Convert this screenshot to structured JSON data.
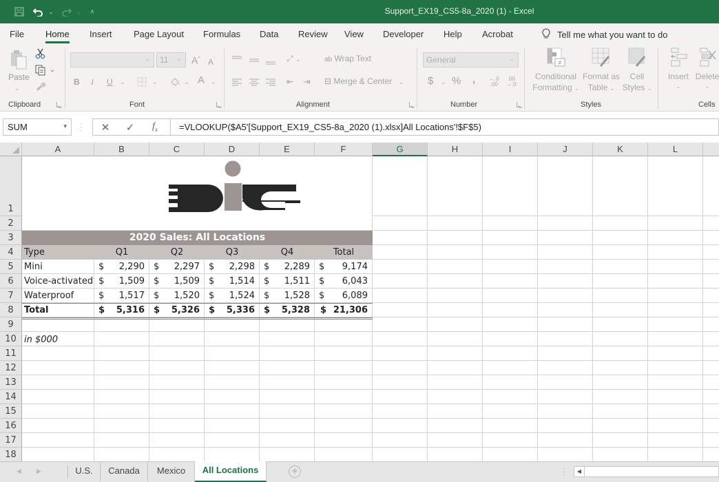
{
  "window": {
    "title": "Support_EX19_CS5-8a_2020 (1)  -  Excel",
    "qat": [
      "save-icon",
      "undo-icon",
      "redo-icon",
      "customize-qat-icon"
    ]
  },
  "ribbon_tabs": [
    {
      "label": "File"
    },
    {
      "label": "Home",
      "active": true
    },
    {
      "label": "Insert"
    },
    {
      "label": "Page Layout"
    },
    {
      "label": "Formulas"
    },
    {
      "label": "Data"
    },
    {
      "label": "Review"
    },
    {
      "label": "View"
    },
    {
      "label": "Developer"
    },
    {
      "label": "Help"
    },
    {
      "label": "Acrobat"
    }
  ],
  "tell_me": "Tell me what you want to do",
  "ribbon": {
    "clipboard": {
      "label": "Clipboard",
      "paste": "Paste"
    },
    "font": {
      "label": "Font",
      "font_name": "",
      "font_size": "11",
      "bold": "B",
      "italic": "I",
      "underline": "U"
    },
    "alignment": {
      "label": "Alignment",
      "wrap_text": "Wrap Text",
      "merge_center": "Merge & Center"
    },
    "number": {
      "label": "Number",
      "format": "General",
      "currency": "$",
      "percent": "%",
      "comma": ","
    },
    "styles": {
      "label": "Styles",
      "conditional_1": "Conditional",
      "conditional_2": "Formatting",
      "format_table_1": "Format as",
      "format_table_2": "Table",
      "cell_styles_1": "Cell",
      "cell_styles_2": "Styles"
    },
    "cells": {
      "label": "Cells",
      "insert": "Insert",
      "delete": "Delete"
    }
  },
  "formula_bar": {
    "name_box": "SUM",
    "formula": "=VLOOKUP($A5'[Support_EX19_CS5-8a_2020 (1).xlsx]All Locations'!$F$5)"
  },
  "columns": [
    "A",
    "B",
    "C",
    "D",
    "E",
    "F",
    "G",
    "H",
    "I",
    "J",
    "K",
    "L"
  ],
  "selected_column": "G",
  "rows": [
    "1",
    "2",
    "3",
    "4",
    "5",
    "6",
    "7",
    "8",
    "9",
    "10",
    "11",
    "12",
    "13",
    "14",
    "15",
    "16",
    "17",
    "18"
  ],
  "sheet": {
    "logo_text": "DiG",
    "title": "2020 Sales: All Locations",
    "headers": [
      "Type",
      "Q1",
      "Q2",
      "Q3",
      "Q4",
      "Total"
    ],
    "data_rows": [
      {
        "type": "Mini",
        "values": [
          "2,290",
          "2,297",
          "2,298",
          "2,289",
          "9,174"
        ]
      },
      {
        "type": "Voice-activated",
        "values": [
          "1,509",
          "1,509",
          "1,514",
          "1,511",
          "6,043"
        ]
      },
      {
        "type": "Waterproof",
        "values": [
          "1,517",
          "1,520",
          "1,524",
          "1,528",
          "6,089"
        ]
      }
    ],
    "total_row": {
      "type": "Total",
      "values": [
        "5,316",
        "5,326",
        "5,336",
        "5,328",
        "21,306"
      ]
    },
    "currency_symbol": "$",
    "note": "in $000"
  },
  "sheet_tabs": [
    {
      "label": "U.S."
    },
    {
      "label": "Canada"
    },
    {
      "label": "Mexico"
    },
    {
      "label": "All Locations",
      "active": true
    }
  ],
  "colors": {
    "excel_green": "#217346",
    "title_band": "#9e9593",
    "header_band": "#c8c2c0"
  }
}
